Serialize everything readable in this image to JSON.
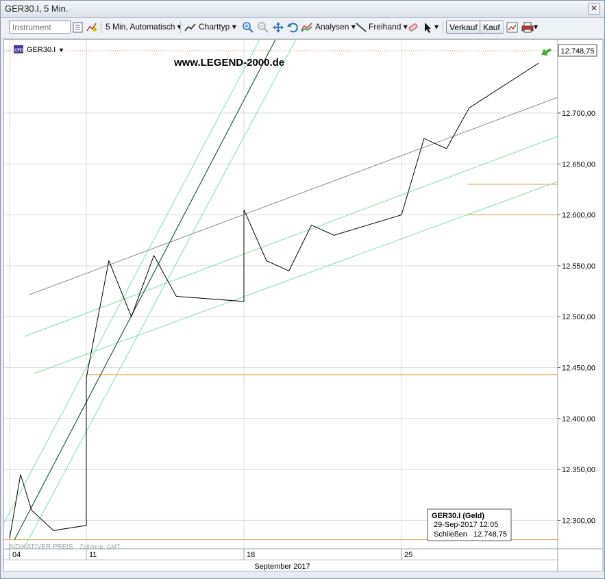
{
  "window": {
    "title": "GER30.I, 5 Min.",
    "close_glyph": "✕"
  },
  "toolbar": {
    "instrument_placeholder": "Instrument",
    "interval_label": "5 Min,  Automatisch",
    "charttype_label": "Charttyp",
    "analysen_label": "Analysen",
    "freihand_label": "Freihand",
    "verkauf_label": "Verkauf",
    "kauf_label": "Kauf"
  },
  "chart_data": {
    "type": "line",
    "symbol": "GER30.I",
    "watermark": "www.LEGEND-2000.de",
    "provider": "INDIKATIVER PREIS",
    "timezone": "Zeitzone: GMT",
    "month_label": "September 2017",
    "x_ticks": [
      "04",
      "11",
      "18",
      "25"
    ],
    "y_ticks": [
      "12.300,00",
      "12.350,00",
      "12.400,00",
      "12.450,00",
      "12.500,00",
      "12.550,00",
      "12.600,00",
      "12.650,00",
      "12.700,00"
    ],
    "y_tick_values": [
      12300,
      12350,
      12400,
      12450,
      12500,
      12550,
      12600,
      12650,
      12700
    ],
    "ylim": [
      12272,
      12772
    ],
    "last_price_label": "12.748,75",
    "last_price": 12748.75,
    "tooltip": {
      "title": "GER30.I (Geld)",
      "datetime": "29-Sep-2017 12:05",
      "close_label": "Schließen",
      "close_value": "12.748,75"
    },
    "horizontal_levels": [
      12630,
      12600,
      12443,
      12281
    ],
    "series": [
      {
        "x": [
          "2017-09-04",
          "2017-09-05",
          "2017-09-06",
          "2017-09-07",
          "2017-09-08",
          "2017-09-11",
          "2017-09-11",
          "2017-09-12",
          "2017-09-13",
          "2017-09-14",
          "2017-09-15",
          "2017-09-18",
          "2017-09-18",
          "2017-09-19",
          "2017-09-20",
          "2017-09-21",
          "2017-09-22",
          "2017-09-25",
          "2017-09-25",
          "2017-09-26",
          "2017-09-27",
          "2017-09-28",
          "2017-09-29"
        ],
        "values": [
          12282,
          12345,
          12310,
          12300,
          12290,
          12295,
          12440,
          12555,
          12500,
          12560,
          12520,
          12515,
          12605,
          12555,
          12545,
          12590,
          12580,
          12600,
          12600,
          12675,
          12665,
          12705,
          12749
        ]
      }
    ]
  }
}
